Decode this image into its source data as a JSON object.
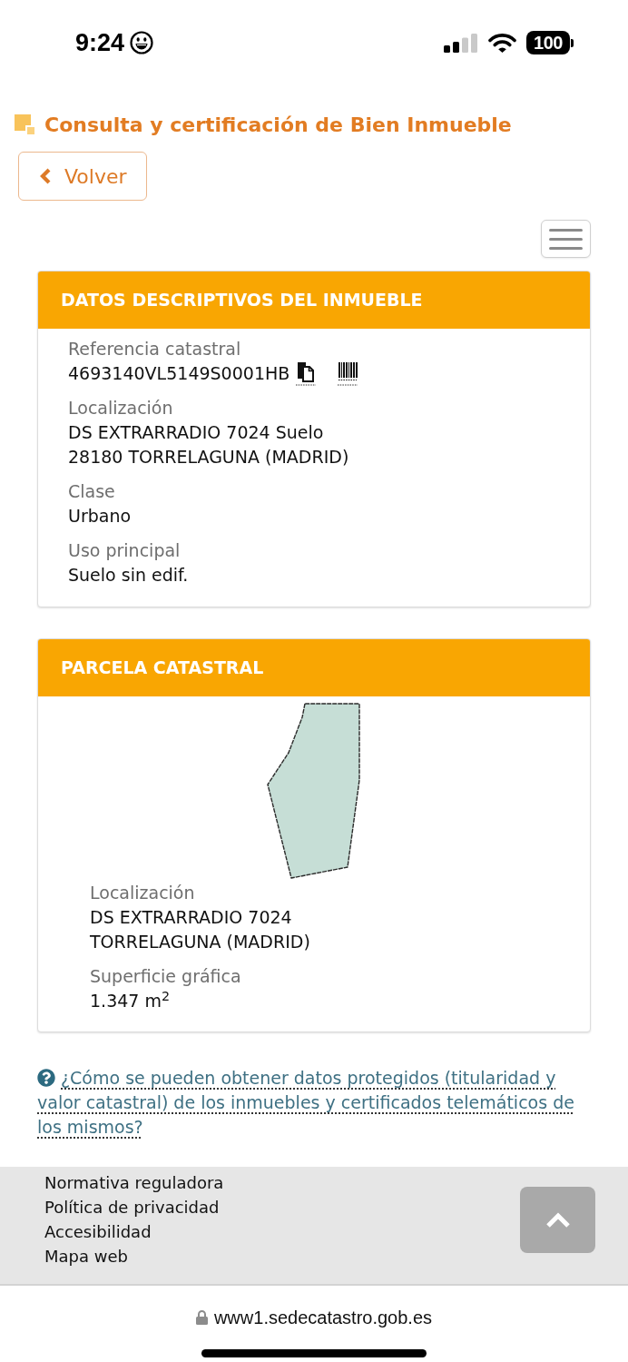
{
  "status_bar": {
    "time": "9:24",
    "battery": "100"
  },
  "header": {
    "title": "Consulta y certificación de Bien Inmueble",
    "back_button": "Volver"
  },
  "sections": [
    {
      "kind": "descriptive",
      "title": "DATOS DESCRIPTIVOS DEL INMUEBLE",
      "fields": [
        {
          "kind": "reference",
          "label": "Referencia catastral",
          "lines": [
            "4693140VL5149S0001HB"
          ]
        },
        {
          "kind": "text",
          "label": "Localización",
          "lines": [
            "DS EXTRARRADIO 7024 Suelo",
            "28180 TORRELAGUNA (MADRID)"
          ]
        },
        {
          "kind": "text",
          "label": "Clase",
          "lines": [
            "Urbano"
          ]
        },
        {
          "kind": "text",
          "label": "Uso principal",
          "lines": [
            "Suelo sin edif."
          ]
        }
      ]
    },
    {
      "kind": "parcel",
      "title": "PARCELA CATASTRAL",
      "fields": [
        {
          "kind": "text",
          "label": "Localización",
          "lines": [
            "DS EXTRARRADIO 7024",
            "TORRELAGUNA (MADRID)"
          ]
        },
        {
          "kind": "text",
          "label": "Superficie gráfica",
          "lines": [
            "1.347 m$^{2}$"
          ]
        }
      ]
    }
  ],
  "help": {
    "link": "¿Cómo se pueden obtener datos protegidos (titularidad y valor catastral) de los inmuebles y certificados telemáticos de los mismos?"
  },
  "footer": {
    "links": [
      "Normativa reguladora",
      "Política de privacidad",
      "Accesibilidad",
      "Mapa web"
    ]
  },
  "browser": {
    "url": "www1.sedecatastro.gob.es"
  }
}
